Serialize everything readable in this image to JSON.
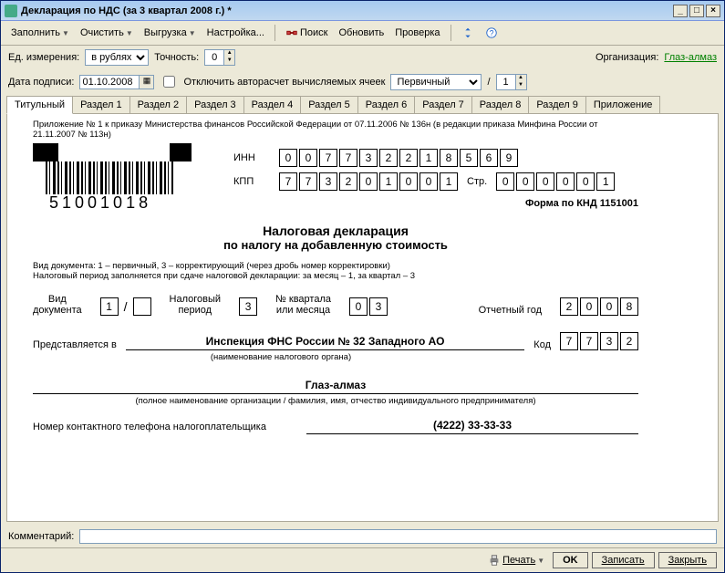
{
  "title": "Декларация по НДС (за 3 квартал 2008 г.) *",
  "toolbar": {
    "fill": "Заполнить",
    "clear": "Очистить",
    "export": "Выгрузка",
    "settings": "Настройка...",
    "search": "Поиск",
    "refresh": "Обновить",
    "check": "Проверка"
  },
  "top": {
    "unit_label": "Ед. измерения:",
    "unit_value": "в рублях",
    "precision_label": "Точность:",
    "precision_value": "0",
    "org_label": "Организация:",
    "org_value": "Глаз-алмаз",
    "date_label": "Дата подписи:",
    "date_value": "01.10.2008",
    "autocalc_label": "Отключить авторасчет вычисляемых ячеек",
    "type_value": "Первичный",
    "type_num": "1"
  },
  "tabs": [
    "Титульный",
    "Раздел 1",
    "Раздел 2",
    "Раздел 3",
    "Раздел 4",
    "Раздел 5",
    "Раздел 6",
    "Раздел 7",
    "Раздел 8",
    "Раздел 9",
    "Приложение"
  ],
  "sheet": {
    "appendix_text": "Приложение № 1 к приказу Министерства финансов Российской Федерации от 07.11.2006 № 136н (в редакции приказа Минфина России от 21.11.2007 № 113н)",
    "barcode_number": "51001018",
    "inn_label": "ИНН",
    "inn": [
      "0",
      "0",
      "7",
      "7",
      "3",
      "2",
      "2",
      "1",
      "8",
      "5",
      "6",
      "9"
    ],
    "kpp_label": "КПП",
    "kpp": [
      "7",
      "7",
      "3",
      "2",
      "0",
      "1",
      "0",
      "0",
      "1"
    ],
    "page_label": "Стр.",
    "page": [
      "0",
      "0",
      "0",
      "0",
      "0",
      "1"
    ],
    "form_code_label": "Форма по КНД 1151001",
    "main_title": "Налоговая декларация",
    "main_subtitle": "по налогу на добавленную стоимость",
    "note1": "Вид документа: 1 – первичный, 3 – корректирующий (через дробь номер корректировки)",
    "note2": "Налоговый период заполняется при сдаче налоговой декларации: за месяц – 1, за квартал – 3",
    "doc_kind_label": "Вид\nдокумента",
    "doc_kind_value": "1",
    "doc_kind_corr": "",
    "tax_period_label": "Налоговый\nпериод",
    "tax_period_value": "3",
    "quarter_label": "№ квартала\nили месяца",
    "quarter": [
      "0",
      "3"
    ],
    "year_label": "Отчетный год",
    "year": [
      "2",
      "0",
      "0",
      "8"
    ],
    "present_label": "Представляется в",
    "present_value": "Инспекция ФНС России № 32 Западного АО",
    "present_note": "(наименование налогового органа)",
    "code_label": "Код",
    "code": [
      "7",
      "7",
      "3",
      "2"
    ],
    "org_name": "Глаз-алмаз",
    "org_note": "(полное наименование организации / фамилия, имя, отчество индивидуального предпринимателя)",
    "phone_label": "Номер контактного телефона налогоплательщика",
    "phone_value": "(4222) 33-33-33"
  },
  "bottom": {
    "comment_label": "Комментарий:"
  },
  "footer": {
    "print": "Печать",
    "ok": "OK",
    "save": "Записать",
    "close": "Закрыть"
  }
}
